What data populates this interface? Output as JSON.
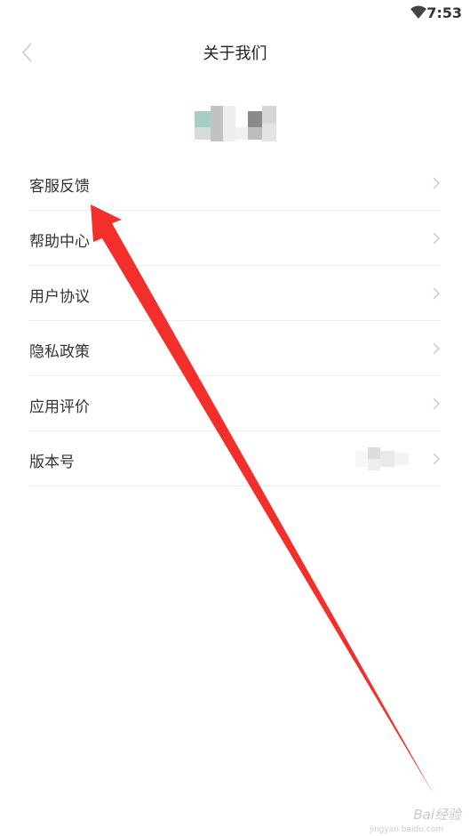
{
  "status_bar": {
    "time": "7:53",
    "wifi_icon": "wifi-icon"
  },
  "header": {
    "back_icon": "back-arrow-icon",
    "title": "关于我们"
  },
  "menu": {
    "items": [
      {
        "label": "客服反馈",
        "icon": "chevron-right-icon"
      },
      {
        "label": "帮助中心",
        "icon": "chevron-right-icon"
      },
      {
        "label": "用户协议",
        "icon": "chevron-right-icon"
      },
      {
        "label": "隐私政策",
        "icon": "chevron-right-icon"
      },
      {
        "label": "应用评价",
        "icon": "chevron-right-icon"
      },
      {
        "label": "版本号",
        "icon": "chevron-right-icon"
      }
    ]
  },
  "colors": {
    "annotation_arrow": "#f22f2a",
    "text_primary": "#333333",
    "divider": "#eeeeee"
  },
  "watermark": {
    "main": "Bai经验",
    "sub": "jingyan.baidu.com"
  }
}
